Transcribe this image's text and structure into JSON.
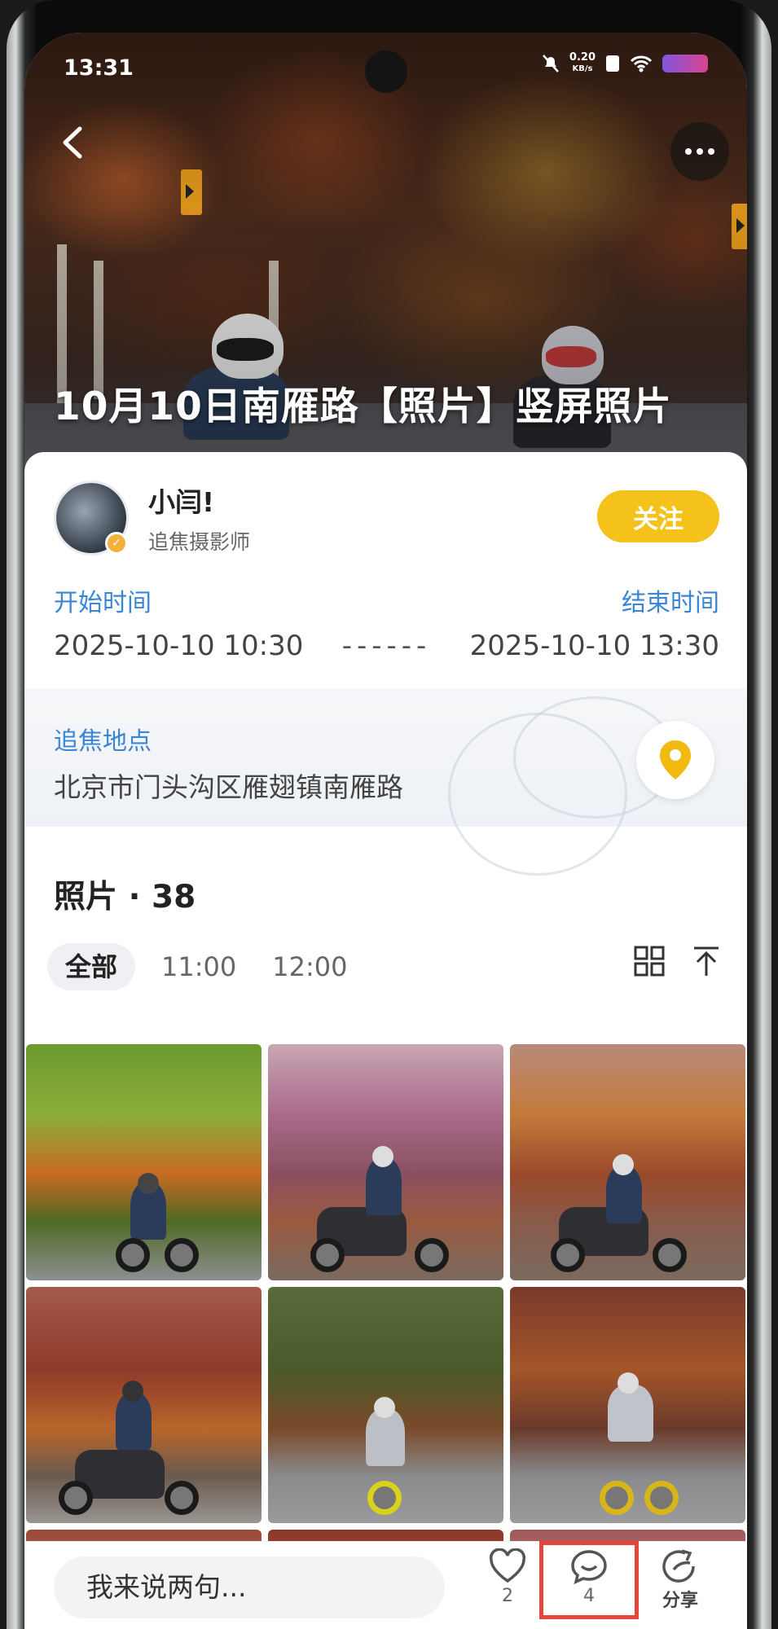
{
  "status_bar": {
    "time": "13:31",
    "speed_value": "0.20",
    "speed_unit": "KB/s"
  },
  "hero": {
    "title": "10月10日南雁路【照片】竖屏照片"
  },
  "author": {
    "name": "小闫!",
    "role": "追焦摄影师",
    "follow_label": "关注"
  },
  "schedule": {
    "start_label": "开始时间",
    "end_label": "结束时间",
    "start_value": "2025-10-10 10:30",
    "end_value": "2025-10-10 13:30",
    "separator": "------"
  },
  "location": {
    "label": "追焦地点",
    "value": "北京市门头沟区雁翅镇南雁路"
  },
  "photos": {
    "title": "照片 · 38",
    "tabs": [
      "全部",
      "11:00",
      "12:00"
    ]
  },
  "bottom_bar": {
    "comment_placeholder": "我来说两句...",
    "like_count": "2",
    "comment_count": "4",
    "share_label": "分享"
  },
  "colors": {
    "accent_blue": "#3a86d6",
    "follow_yellow": "#f4c21b",
    "highlight_red": "#e3473c"
  },
  "icons": [
    "back-icon",
    "more-icon",
    "location-pin-icon",
    "grid-view-icon",
    "scroll-top-icon",
    "like-icon",
    "comment-icon",
    "share-icon"
  ]
}
